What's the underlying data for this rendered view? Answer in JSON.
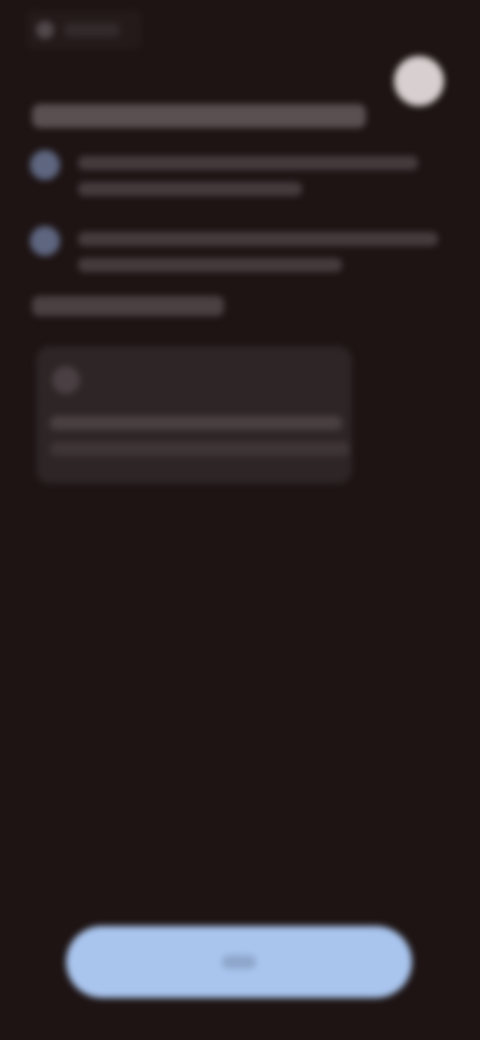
{
  "colors": {
    "background": "#1e1414",
    "avatar": "#d8d0d0",
    "option_icon": "#5e6680",
    "card": "#2e2526",
    "primary_button": "#a9c5ee"
  },
  "header": {
    "chip_icon": "circle-icon",
    "avatar_icon": "avatar-icon"
  },
  "options": [
    {
      "icon": "option-icon"
    },
    {
      "icon": "option-icon"
    }
  ],
  "card": {
    "icon": "card-icon"
  }
}
